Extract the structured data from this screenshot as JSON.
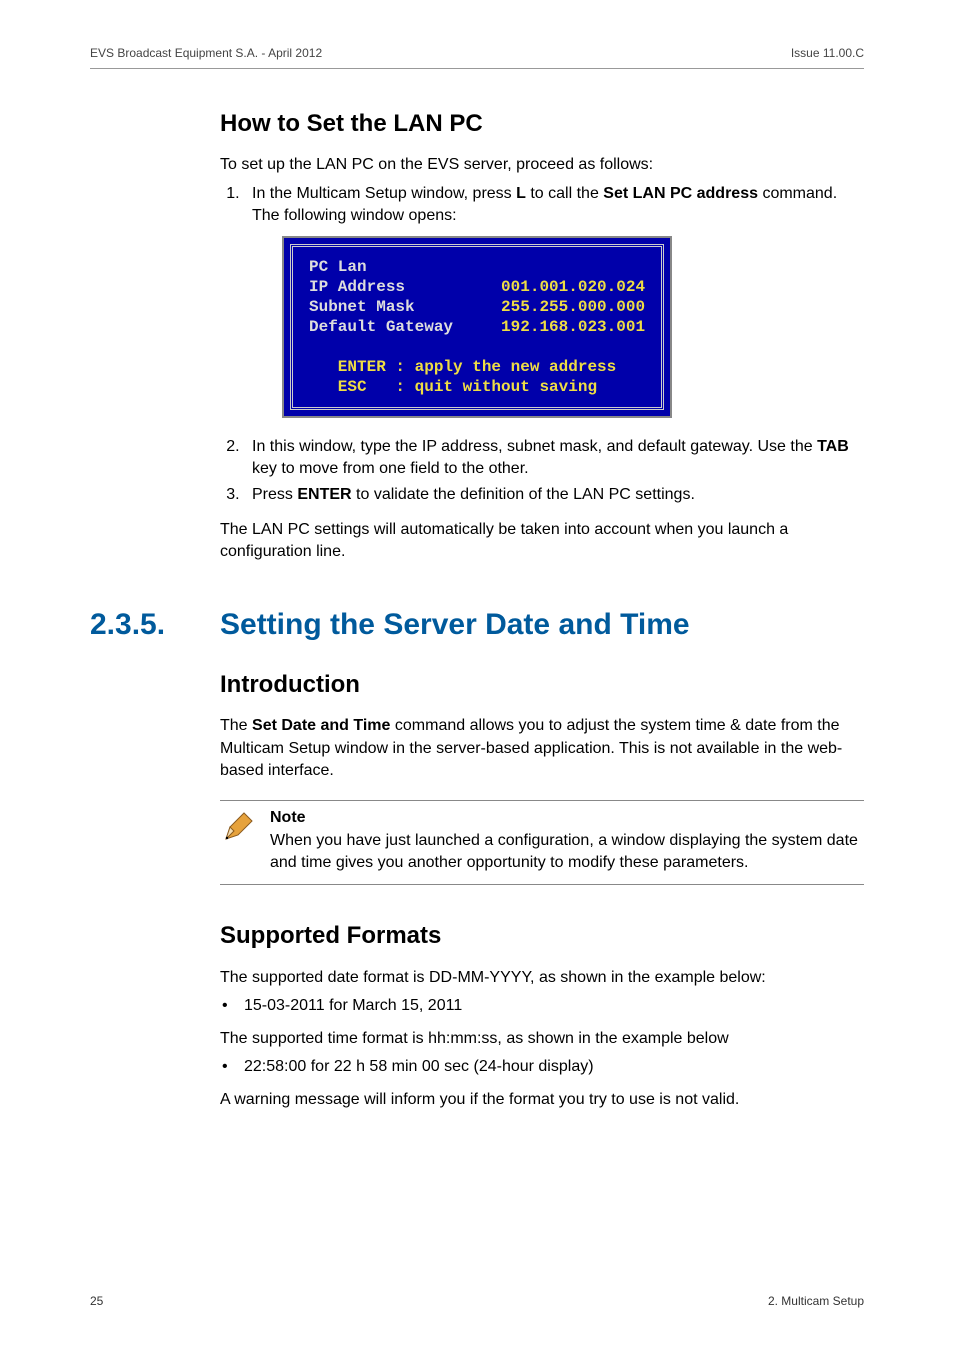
{
  "header": {
    "left": "EVS Broadcast Equipment S.A.  - April 2012",
    "right": "Issue 11.00.C"
  },
  "sec1": {
    "title": "How to Set the LAN PC",
    "intro": "To set up the LAN PC on the EVS server, proceed as follows:",
    "step1_a": "In the Multicam Setup window, press ",
    "step1_b": "L",
    "step1_c": " to call the ",
    "step1_d": "Set LAN PC address",
    "step1_e": " command. The following window opens:",
    "dos": {
      "l1": "PC Lan",
      "l2a": "IP Address          ",
      "l2b": "001.001.020.024",
      "l3a": "Subnet Mask         ",
      "l3b": "255.255.000.000",
      "l4a": "Default Gateway     ",
      "l4b": "192.168.023.001",
      "l5": "   ENTER : apply the new address",
      "l6": "   ESC   : quit without saving"
    },
    "step2_a": "In this window, type the IP address, subnet mask, and default gateway. Use the ",
    "step2_b": "TAB",
    "step2_c": " key to move from one field to the other.",
    "step3_a": "Press ",
    "step3_b": "ENTER",
    "step3_c": " to validate the definition of the LAN PC settings.",
    "outro": "The LAN PC settings will automatically be taken into account when you launch a configuration line."
  },
  "sec2": {
    "number": "2.3.5.",
    "title": "Setting the Server Date and Time",
    "intro_head": "Introduction",
    "intro_p1_a": "The ",
    "intro_p1_b": "Set Date and Time",
    "intro_p1_c": " command allows you to adjust the system time & date from the Multicam Setup window in the server-based application. This is not available in the web-based interface.",
    "note_label": "Note",
    "note_body": "When you have just launched a configuration, a window displaying the system date and time gives you another opportunity to modify these parameters.",
    "formats_head": "Supported Formats",
    "fmt_p1": "The supported date format is DD-MM-YYYY, as shown in the example below:",
    "fmt_b1": "15-03-2011 for March 15, 2011",
    "fmt_p2": "The supported time format is hh:mm:ss, as shown in the example below",
    "fmt_b2": "22:58:00 for 22 h 58 min 00 sec (24-hour display)",
    "fmt_p3": "A warning message will inform you if the format you try to use is not valid."
  },
  "footer": {
    "left": "25",
    "right": "2. Multicam Setup"
  }
}
